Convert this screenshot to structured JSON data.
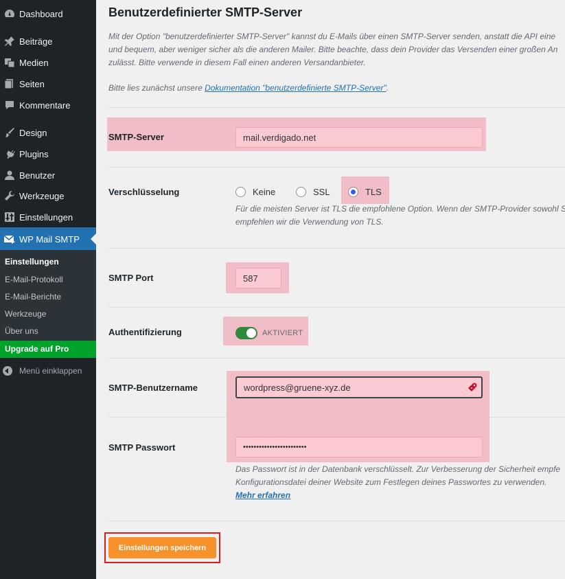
{
  "sidebar": {
    "items": [
      {
        "label": "Dashboard",
        "icon": "dashboard-icon"
      },
      {
        "label": "Beiträge",
        "icon": "pin-icon"
      },
      {
        "label": "Medien",
        "icon": "media-icon"
      },
      {
        "label": "Seiten",
        "icon": "pages-icon"
      },
      {
        "label": "Kommentare",
        "icon": "comments-icon"
      },
      {
        "label": "Design",
        "icon": "brush-icon"
      },
      {
        "label": "Plugins",
        "icon": "plugin-icon"
      },
      {
        "label": "Benutzer",
        "icon": "user-icon"
      },
      {
        "label": "Werkzeuge",
        "icon": "wrench-icon"
      },
      {
        "label": "Einstellungen",
        "icon": "settings-icon"
      },
      {
        "label": "WP Mail SMTP",
        "icon": "mail-icon"
      }
    ],
    "submenu": [
      "Einstellungen",
      "E-Mail-Protokoll",
      "E-Mail-Berichte",
      "Werkzeuge",
      "Über uns"
    ],
    "upgrade": "Upgrade auf Pro",
    "collapse": "Menü einklappen"
  },
  "main": {
    "title": "Benutzerdefinierter SMTP-Server",
    "desc_line1": "Mit der Option \"benutzerdefinierter SMTP-Server\" kannst du E-Mails über einen SMTP-Server senden, anstatt die API eine",
    "desc_line2": "und bequem, aber weniger sicher als die anderen Mailer. Bitte beachte, dass dein Provider das Versenden einer großen An",
    "desc_line3": "zulässt. Bitte verwende in diesem Fall einen anderen Versandanbieter.",
    "doc_prefix": "Bitte lies zunächst unsere",
    "doc_link": "Dokumentation \"benutzerdefinierte SMTP-Server\"",
    "doc_suffix": "."
  },
  "smtp_server": {
    "label": "SMTP-Server",
    "value": "mail.verdigado.net"
  },
  "encryption": {
    "label": "Verschlüsselung",
    "options": [
      "Keine",
      "SSL",
      "TLS"
    ],
    "selected": "TLS",
    "help_line1": "Für die meisten Server ist TLS die empfohlene Option. Wenn der SMTP-Provider sowohl S",
    "help_line2": "empfehlen wir die Verwendung von TLS."
  },
  "port": {
    "label": "SMTP Port",
    "value": "587"
  },
  "auth": {
    "label": "Authentifizierung",
    "state": "AKTIVIERT",
    "enabled": true
  },
  "username": {
    "label": "SMTP-Benutzername",
    "value": "wordpress@gruene-xyz.de"
  },
  "password": {
    "label": "SMTP Passwort",
    "value": "••••••••••••••••••••••••",
    "help_line1": "Das Passwort ist in der Datenbank verschlüsselt. Zur Verbesserung der Sicherheit empfe",
    "help_line2": "Konfigurationsdatei deiner Website zum Festlegen deines Passwortes zu verwenden.",
    "more_link": "Mehr erfahren"
  },
  "save_label": "Einstellungen speichern",
  "colors": {
    "accent": "#2271b1",
    "save": "#f7912a",
    "highlight": "#f1bdc6",
    "upgrade": "#00a32a"
  }
}
